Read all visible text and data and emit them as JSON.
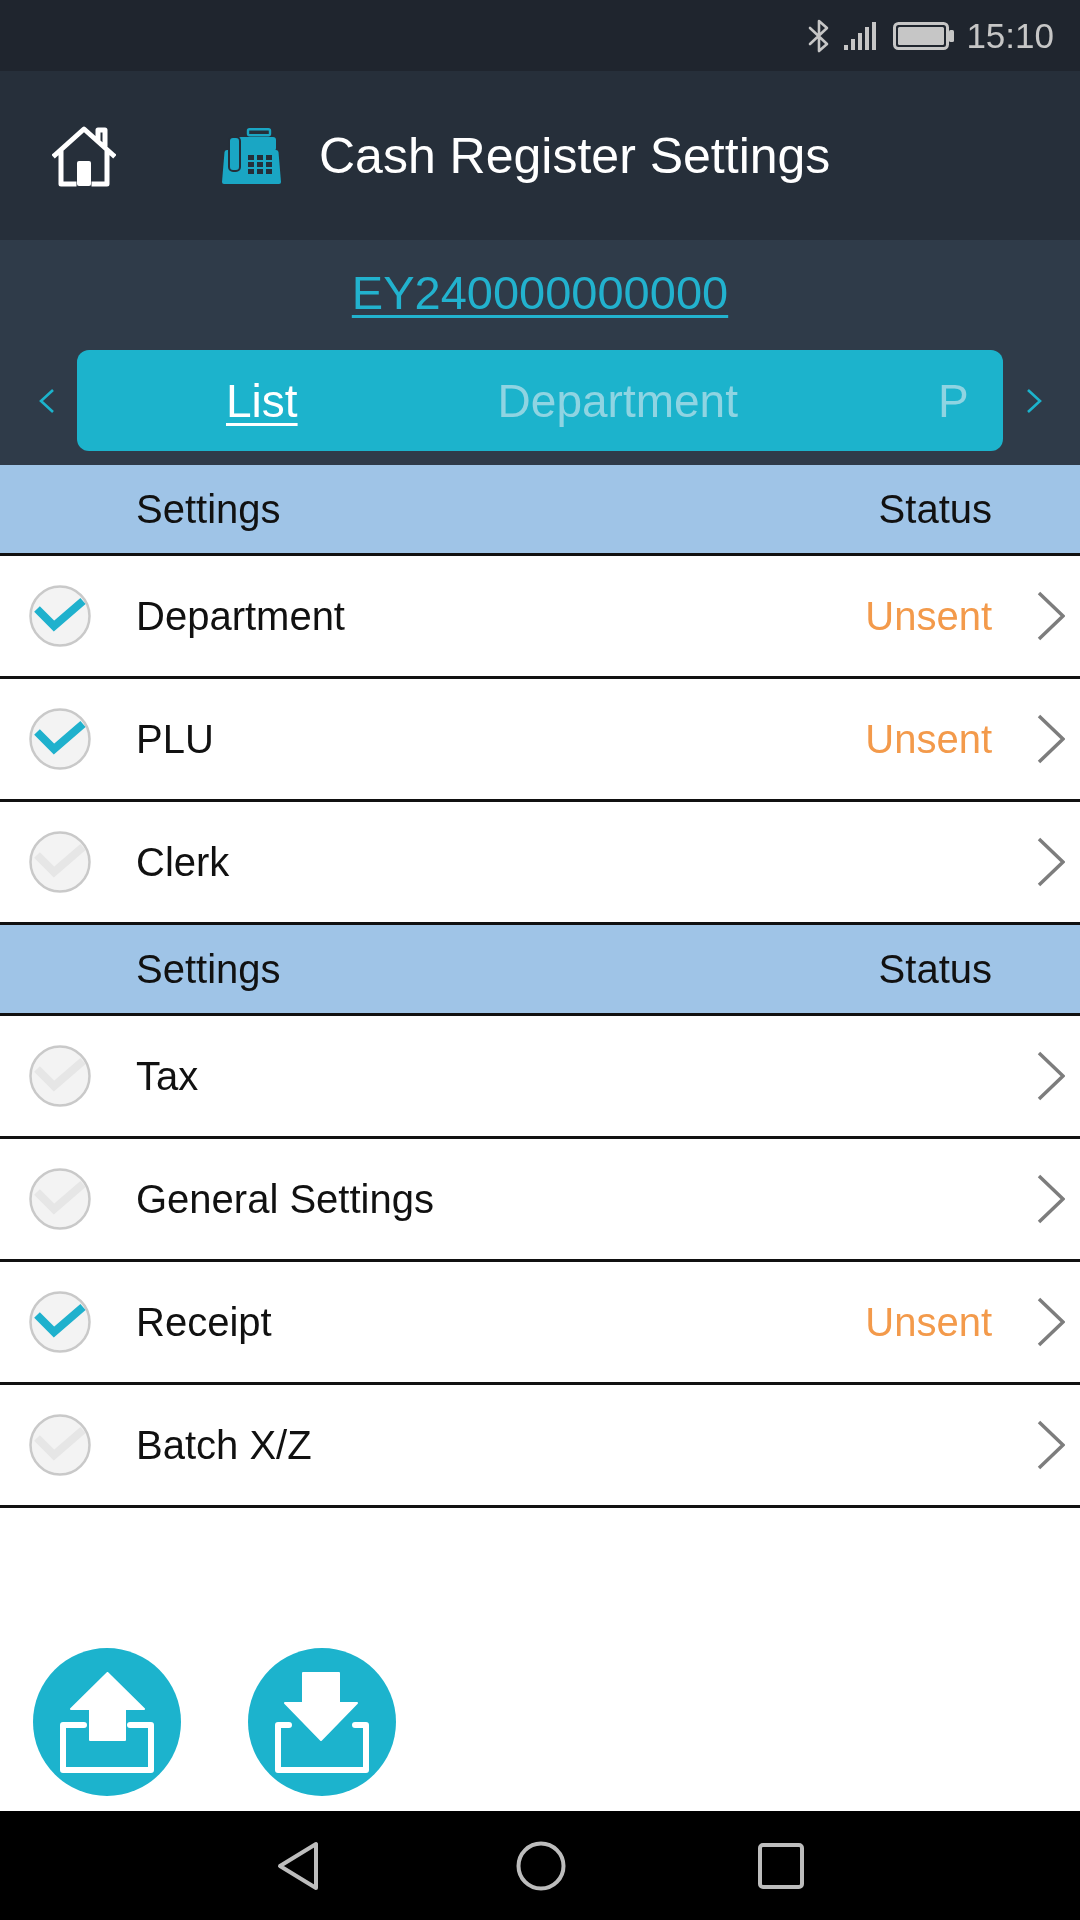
{
  "status_bar": {
    "time": "15:10"
  },
  "app_bar": {
    "title": "Cash Register Settings"
  },
  "device": {
    "serial": "EY240000000000"
  },
  "tabs": [
    {
      "label": "List",
      "selected": true
    },
    {
      "label": "Department",
      "selected": false
    },
    {
      "label": "P",
      "selected": false
    }
  ],
  "sections": [
    {
      "columns": [
        "Settings",
        "Status"
      ],
      "rows": [
        {
          "label": "Department",
          "checked": true,
          "status": "Unsent"
        },
        {
          "label": "PLU",
          "checked": true,
          "status": "Unsent"
        },
        {
          "label": "Clerk",
          "checked": false
        }
      ]
    },
    {
      "columns": [
        "Settings",
        "Status"
      ],
      "rows": [
        {
          "label": "Tax",
          "checked": false
        },
        {
          "label": "General Settings",
          "checked": false
        },
        {
          "label": "Receipt",
          "checked": true,
          "status": "Unsent"
        },
        {
          "label": "Batch X/Z",
          "checked": false
        }
      ]
    }
  ]
}
